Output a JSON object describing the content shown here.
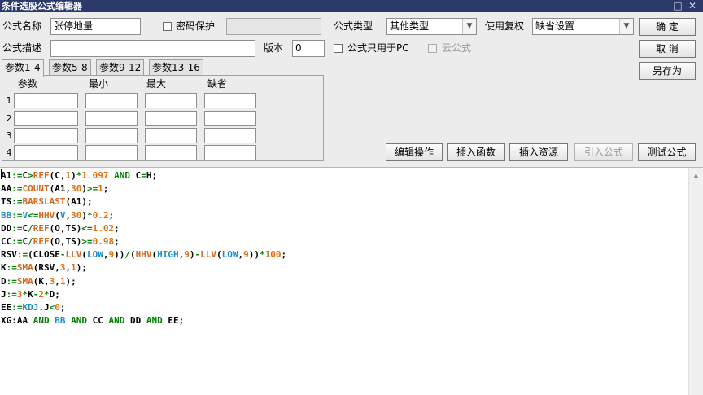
{
  "window": {
    "title": "条件选股公式编辑器",
    "minimize_glyph": "□",
    "close_glyph": "✕"
  },
  "form": {
    "name_label": "公式名称",
    "name_value": "张停地量",
    "password_label": "密码保护",
    "password_checked": false,
    "password_value": "",
    "type_label": "公式类型",
    "type_value": "其他类型",
    "rights_label": "使用复权",
    "rights_value": "缺省设置",
    "desc_label": "公式描述",
    "desc_value": "",
    "version_label": "版本",
    "version_value": "0",
    "pc_only_label": "公式只用于PC",
    "pc_only_checked": false,
    "cloud_label": "云公式",
    "cloud_checked": false,
    "cloud_disabled": true
  },
  "buttons": {
    "ok": "确  定",
    "cancel": "取  消",
    "save_as": "另存为",
    "edit_ops": "编辑操作",
    "insert_func": "插入函数",
    "insert_res": "插入资源",
    "import_formula": "引入公式",
    "test_formula": "测试公式"
  },
  "tabs": [
    "参数1-4",
    "参数5-8",
    "参数9-12",
    "参数13-16"
  ],
  "params": {
    "headers": [
      "参数",
      "最小",
      "最大",
      "缺省"
    ],
    "rows": [
      "1",
      "2",
      "3",
      "4"
    ]
  },
  "colors": {
    "titlebar": "#2b3a6b",
    "func": "#d2691e",
    "number": "#e0700e",
    "keyword": "#008000",
    "blue_var": "#1c8dc8",
    "editor_bg": "#ffffff"
  },
  "code": {
    "lines": [
      "A1:=C>REF(C,1)*1.097 AND C=H;",
      "AA:=COUNT(A1,30)>=1;",
      "TS:=BARSLAST(A1);",
      "BB:=V<=HHV(V,30)*0.2;",
      "DD:=C/REF(O,TS)<=1.02;",
      "CC:=C/REF(O,TS)>=0.98;",
      "RSV:=(CLOSE-LLV(LOW,9))/(HHV(HIGH,9)-LLV(LOW,9))*100;",
      "K:=SMA(RSV,3,1);",
      "D:=SMA(K,3,1);",
      "J:=3*K-2*D;",
      "EE:=KDJ.J<0;",
      "XG:AA AND BB AND CC AND DD AND EE;"
    ]
  }
}
